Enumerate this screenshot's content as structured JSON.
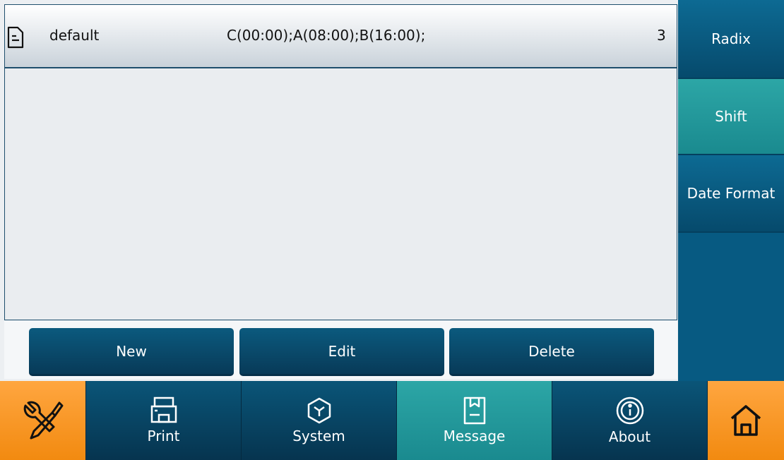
{
  "list": {
    "rows": [
      {
        "name": "default",
        "shifts": "C(00:00);A(08:00);B(16:00);",
        "count": "3",
        "icon": "document-icon"
      }
    ]
  },
  "actions": {
    "new_label": "New",
    "edit_label": "Edit",
    "delete_label": "Delete"
  },
  "sidebar": {
    "items": [
      {
        "label": "Radix",
        "active": false
      },
      {
        "label": "Shift",
        "active": true
      },
      {
        "label": "Date Format",
        "active": false
      }
    ]
  },
  "nav": {
    "tools_icon": "tools-icon",
    "print_label": "Print",
    "system_label": "System",
    "message_label": "Message",
    "about_label": "About",
    "home_icon": "home-icon",
    "active": "Message"
  },
  "colors": {
    "accent_orange": "#f28a10",
    "active_teal": "#1a8a8f",
    "primary_blue": "#075a82"
  }
}
